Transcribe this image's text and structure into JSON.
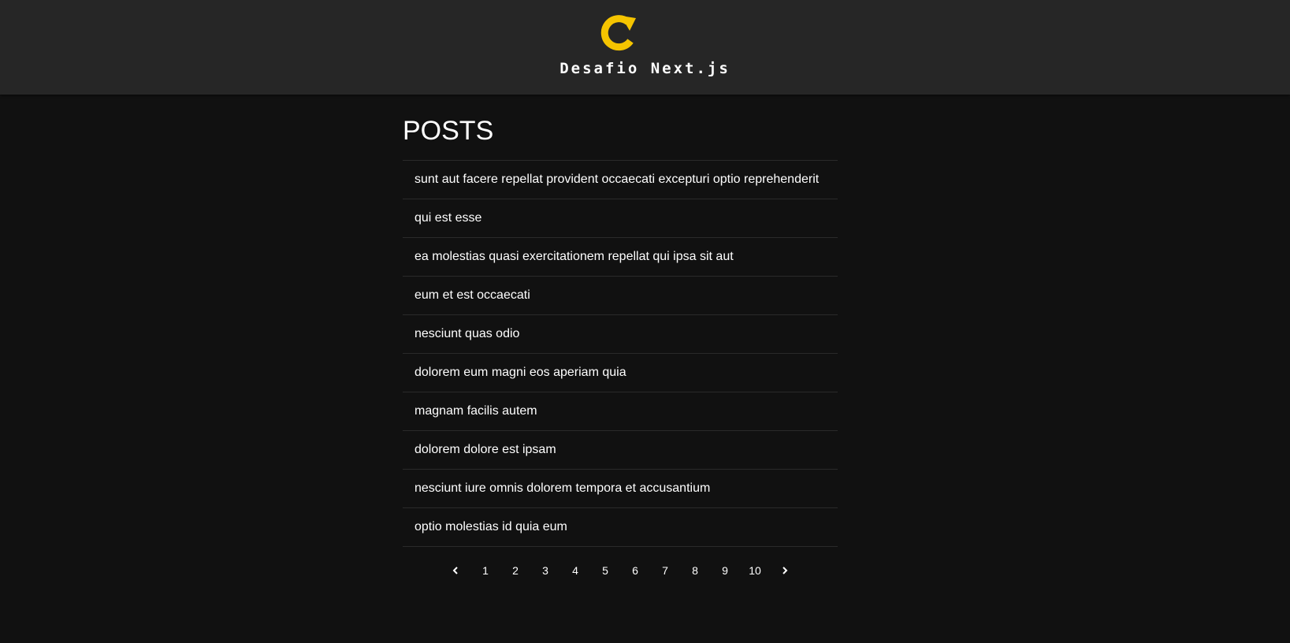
{
  "header": {
    "logo_icon": "refresh-c-logo-icon",
    "logo_color": "#F5C400",
    "title": "Desafio Next.js"
  },
  "main": {
    "title": "POSTS",
    "posts": [
      "sunt aut facere repellat provident occaecati excepturi optio reprehenderit",
      "qui est esse",
      "ea molestias quasi exercitationem repellat qui ipsa sit aut",
      "eum et est occaecati",
      "nesciunt quas odio",
      "dolorem eum magni eos aperiam quia",
      "magnam facilis autem",
      "dolorem dolore est ipsam",
      "nesciunt iure omnis dolorem tempora et accusantium",
      "optio molestias id quia eum"
    ]
  },
  "pagination": {
    "prev_icon": "chevron-left-icon",
    "next_icon": "chevron-right-icon",
    "pages": [
      "1",
      "2",
      "3",
      "4",
      "5",
      "6",
      "7",
      "8",
      "9",
      "10"
    ]
  },
  "colors": {
    "background": "#111111",
    "header_background": "#262626",
    "divider": "#2a2a2a",
    "text": "#ffffff"
  }
}
